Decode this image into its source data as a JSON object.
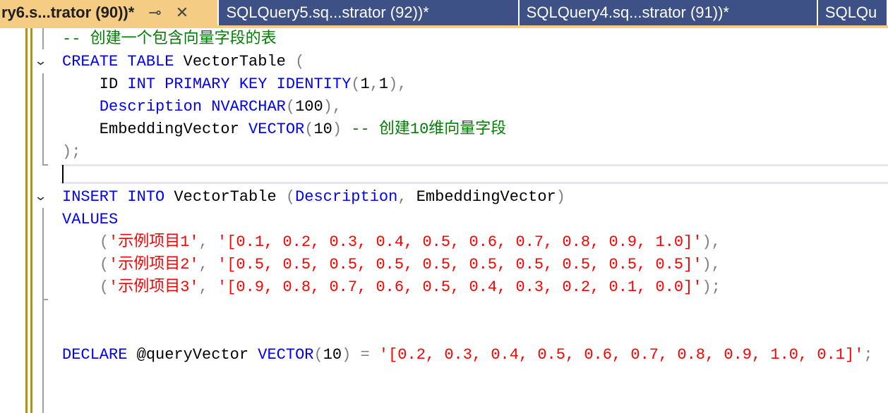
{
  "tabs": [
    {
      "label": "ry6.s...trator (90))*",
      "active": true
    },
    {
      "label": "SQLQuery5.sq...strator (92))*"
    },
    {
      "label": "SQLQuery4.sq...strator (91))*"
    },
    {
      "label": "SQLQu"
    }
  ],
  "icons": {
    "pin": "⊸",
    "close": "✕"
  },
  "colors": {
    "keyword": "#0000ff",
    "comment": "#008000",
    "string": "#ff0000",
    "operator": "#808080",
    "tab_active": "#f5cc84",
    "tab_inactive": "#3e5187"
  },
  "code_lines": [
    [
      [
        "-- 创建一个包含向量字段的表",
        "cm"
      ]
    ],
    [
      [
        "CREATE",
        "kw"
      ],
      [
        " ",
        "id"
      ],
      [
        "TABLE",
        "kw"
      ],
      [
        " VectorTable ",
        "id"
      ],
      [
        "(",
        "op"
      ]
    ],
    [
      [
        "    ID ",
        "id"
      ],
      [
        "INT",
        "kw"
      ],
      [
        " ",
        "id"
      ],
      [
        "PRIMARY",
        "kw"
      ],
      [
        " ",
        "id"
      ],
      [
        "KEY",
        "kw"
      ],
      [
        " ",
        "id"
      ],
      [
        "IDENTITY",
        "kw"
      ],
      [
        "(",
        "op"
      ],
      [
        "1",
        "id"
      ],
      [
        ",",
        "op"
      ],
      [
        "1",
        "id"
      ],
      [
        "),",
        "op"
      ]
    ],
    [
      [
        "    ",
        "id"
      ],
      [
        "Description",
        "kw"
      ],
      [
        " ",
        "id"
      ],
      [
        "NVARCHAR",
        "kw"
      ],
      [
        "(",
        "op"
      ],
      [
        "100",
        "id"
      ],
      [
        "),",
        "op"
      ]
    ],
    [
      [
        "    EmbeddingVector ",
        "id"
      ],
      [
        "VECTOR",
        "kw"
      ],
      [
        "(",
        "op"
      ],
      [
        "10",
        "id"
      ],
      [
        ")",
        "op"
      ],
      [
        " ",
        "id"
      ],
      [
        "-- 创建10维向量字段",
        "cm"
      ]
    ],
    [
      [
        ");",
        "op"
      ]
    ],
    [
      [
        "",
        "id"
      ]
    ],
    [
      [
        "INSERT",
        "kw"
      ],
      [
        " ",
        "id"
      ],
      [
        "INTO",
        "kw"
      ],
      [
        " VectorTable ",
        "id"
      ],
      [
        "(",
        "op"
      ],
      [
        "Description",
        "kw"
      ],
      [
        ",",
        "op"
      ],
      [
        " EmbeddingVector",
        "id"
      ],
      [
        ")",
        "op"
      ]
    ],
    [
      [
        "VALUES",
        "kw"
      ]
    ],
    [
      [
        "    ",
        "id"
      ],
      [
        "(",
        "op"
      ],
      [
        "'示例项目1'",
        "st"
      ],
      [
        ", ",
        "op"
      ],
      [
        "'[0.1, 0.2, 0.3, 0.4, 0.5, 0.6, 0.7, 0.8, 0.9, 1.0]'",
        "st"
      ],
      [
        "),",
        "op"
      ]
    ],
    [
      [
        "    ",
        "id"
      ],
      [
        "(",
        "op"
      ],
      [
        "'示例项目2'",
        "st"
      ],
      [
        ", ",
        "op"
      ],
      [
        "'[0.5, 0.5, 0.5, 0.5, 0.5, 0.5, 0.5, 0.5, 0.5, 0.5]'",
        "st"
      ],
      [
        "),",
        "op"
      ]
    ],
    [
      [
        "    ",
        "id"
      ],
      [
        "(",
        "op"
      ],
      [
        "'示例项目3'",
        "st"
      ],
      [
        ", ",
        "op"
      ],
      [
        "'[0.9, 0.8, 0.7, 0.6, 0.5, 0.4, 0.3, 0.2, 0.1, 0.0]'",
        "st"
      ],
      [
        ");",
        "op"
      ]
    ],
    [
      [
        "",
        "id"
      ]
    ],
    [
      [
        "",
        "id"
      ]
    ],
    [
      [
        "DECLARE",
        "kw"
      ],
      [
        " @queryVector ",
        "id"
      ],
      [
        "VECTOR",
        "kw"
      ],
      [
        "(",
        "op"
      ],
      [
        "10",
        "id"
      ],
      [
        ")",
        "op"
      ],
      [
        " = ",
        "op"
      ],
      [
        "'[0.2, 0.3, 0.4, 0.5, 0.6, 0.7, 0.8, 0.9, 1.0, 0.1]'",
        "st"
      ],
      [
        ";",
        "op"
      ]
    ]
  ]
}
